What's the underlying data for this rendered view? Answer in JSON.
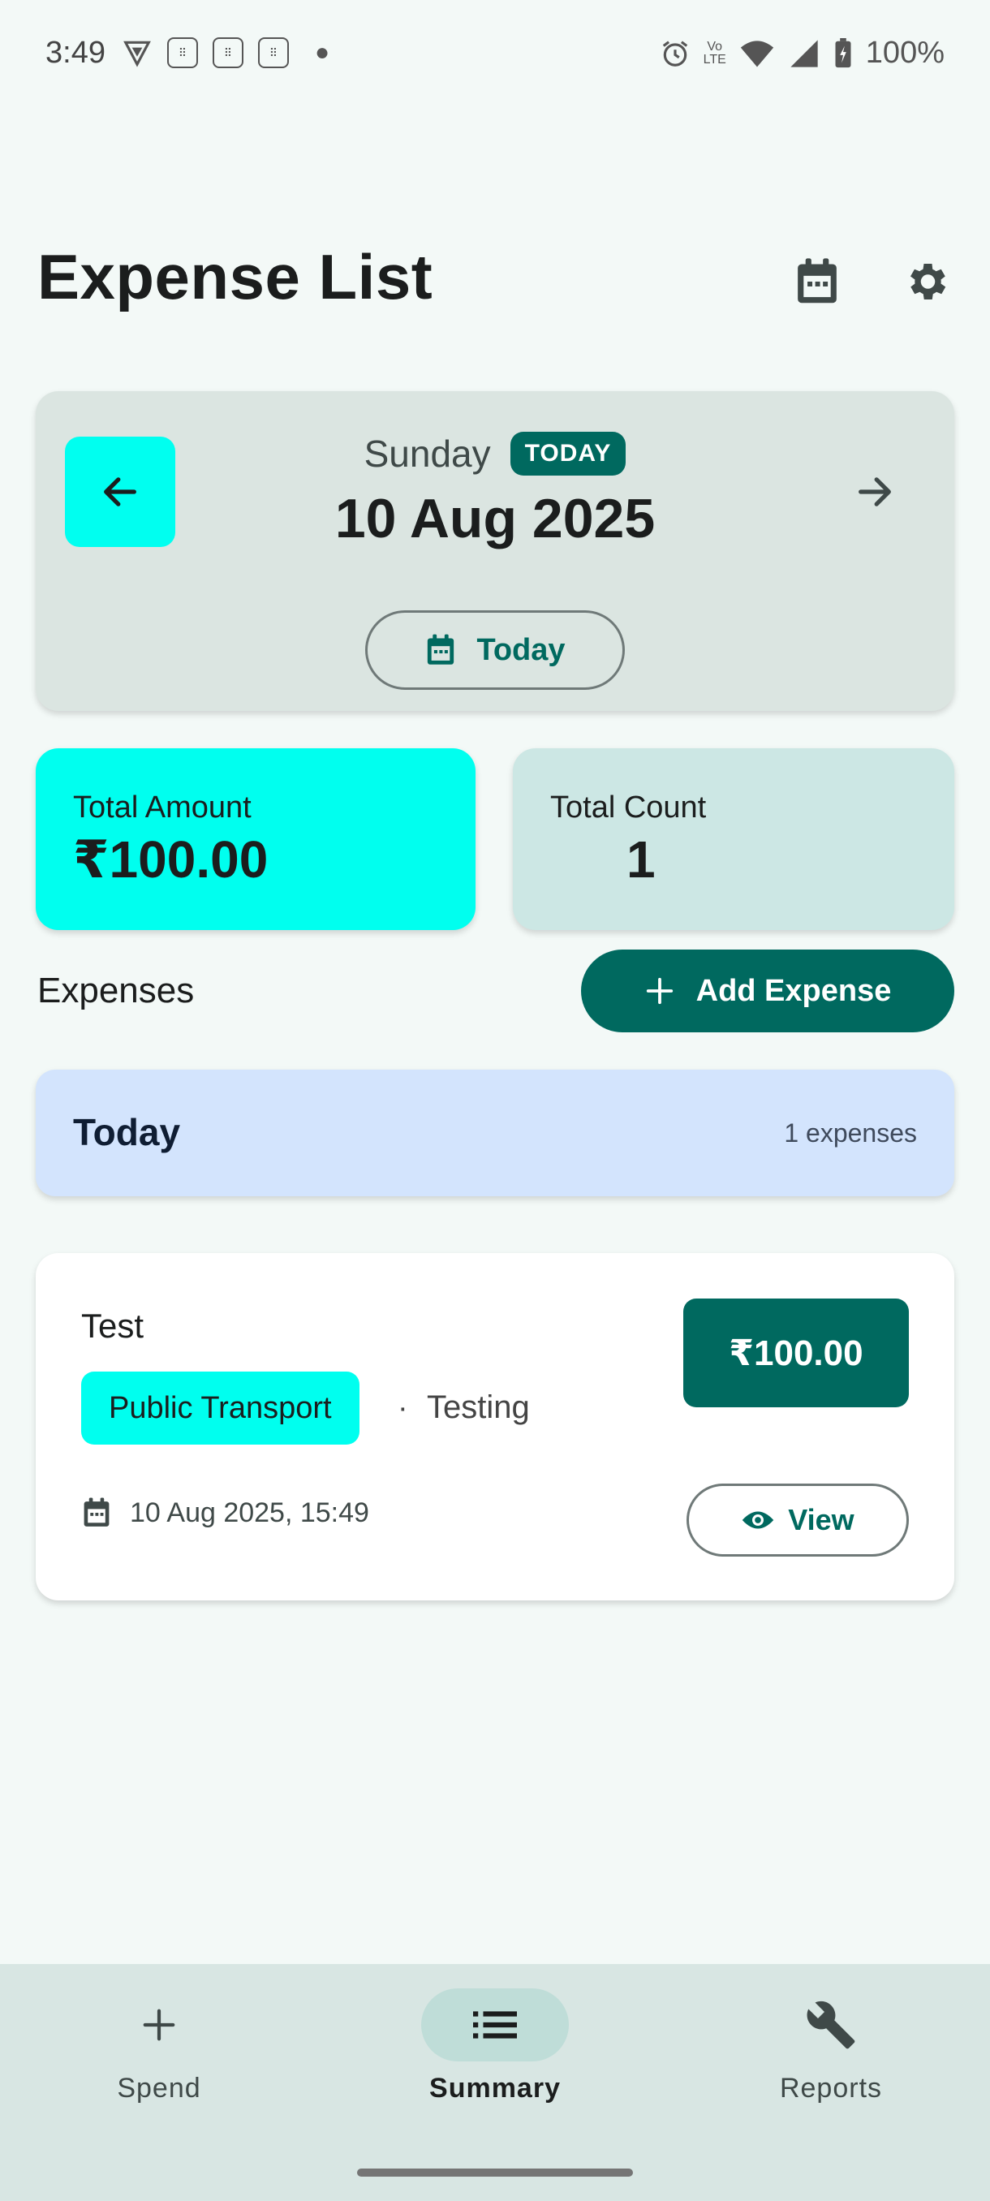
{
  "status_bar": {
    "time": "3:49",
    "battery": "100%"
  },
  "header": {
    "title": "Expense List",
    "icons": [
      "calendar-icon",
      "gear-icon"
    ]
  },
  "date_card": {
    "weekday": "Sunday",
    "badge": "TODAY",
    "date": "10 Aug 2025",
    "today_button": "Today"
  },
  "stats": {
    "total_amount_label": "Total Amount",
    "total_amount_value": "₹100.00",
    "total_count_label": "Total Count",
    "total_count_value": "1"
  },
  "expenses_section": {
    "title": "Expenses",
    "add_button": "Add Expense"
  },
  "groups": [
    {
      "title": "Today",
      "count": "1 expenses",
      "items": [
        {
          "title": "Test",
          "category": "Public Transport",
          "separator": "·",
          "note": "Testing",
          "amount": "₹100.00",
          "datetime": "10 Aug 2025, 15:49",
          "view_button": "View"
        }
      ]
    }
  ],
  "bottom_nav": [
    {
      "label": "Spend",
      "icon": "plus-icon",
      "active": false
    },
    {
      "label": "Summary",
      "icon": "list-icon",
      "active": true
    },
    {
      "label": "Reports",
      "icon": "wrench-icon",
      "active": false
    }
  ],
  "colors": {
    "primary": "#00695F",
    "accent_cyan": "#00FFEF",
    "background": "#F3F9F7",
    "group_header": "#D3E4FD"
  }
}
